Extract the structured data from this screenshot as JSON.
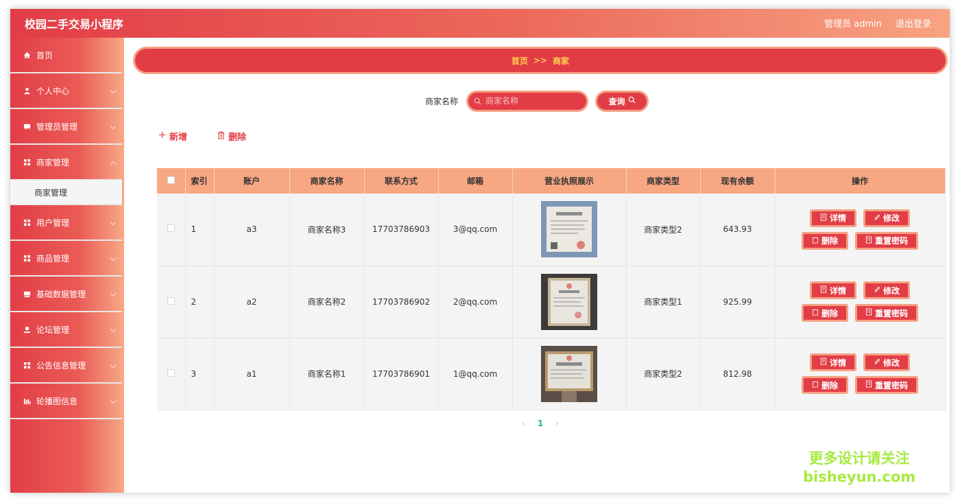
{
  "app": {
    "title": "校园二手交易小程序"
  },
  "header": {
    "admin_label": "管理员 admin",
    "logout_label": "退出登录"
  },
  "sidebar": {
    "items": [
      {
        "label": "首页",
        "icon": "home-icon",
        "expandable": false
      },
      {
        "label": "个人中心",
        "icon": "user-icon",
        "expandable": true
      },
      {
        "label": "管理员管理",
        "icon": "chat-icon",
        "expandable": true
      },
      {
        "label": "商家管理",
        "icon": "grid-icon",
        "expandable": true
      },
      {
        "label": "用户管理",
        "icon": "grid-icon",
        "expandable": true
      },
      {
        "label": "商品管理",
        "icon": "grid-icon",
        "expandable": true
      },
      {
        "label": "基础数据管理",
        "icon": "folder-icon",
        "expandable": true
      },
      {
        "label": "论坛管理",
        "icon": "person-icon",
        "expandable": true
      },
      {
        "label": "公告信息管理",
        "icon": "grid-icon",
        "expandable": true
      },
      {
        "label": "轮播图信息",
        "icon": "chart-icon",
        "expandable": true
      }
    ],
    "submenu_active": "商家管理"
  },
  "breadcrumb": {
    "home": "首页",
    "sep": ">>",
    "current": "商家"
  },
  "search": {
    "label": "商家名称",
    "placeholder": "商家名称",
    "value": "",
    "button_label": "查询"
  },
  "toolbar": {
    "add_label": "新增",
    "delete_label": "删除"
  },
  "table": {
    "columns": [
      "索引",
      "账户",
      "商家名称",
      "联系方式",
      "邮箱",
      "营业执照展示",
      "商家类型",
      "现有余额",
      "操作"
    ],
    "rows": [
      {
        "index": "1",
        "account": "a3",
        "name": "商家名称3",
        "phone": "17703786903",
        "email": "3@qq.com",
        "type": "商家类型2",
        "balance": "643.93"
      },
      {
        "index": "2",
        "account": "a2",
        "name": "商家名称2",
        "phone": "17703786902",
        "email": "2@qq.com",
        "type": "商家类型1",
        "balance": "925.99"
      },
      {
        "index": "3",
        "account": "a1",
        "name": "商家名称1",
        "phone": "17703786901",
        "email": "1@qq.com",
        "type": "商家类型2",
        "balance": "812.98"
      }
    ],
    "row_actions": {
      "detail": "详情",
      "edit": "修改",
      "delete": "删除",
      "reset_password": "重置密码"
    }
  },
  "pagination": {
    "current": "1",
    "prev": "‹",
    "next": "›"
  },
  "watermark": {
    "line1": "更多设计请关注",
    "line2": "bisheyun.com"
  },
  "colors": {
    "primary": "#e23d47",
    "accent": "#f8a783",
    "border": "#f4a184",
    "highlight": "#ffd24a"
  }
}
